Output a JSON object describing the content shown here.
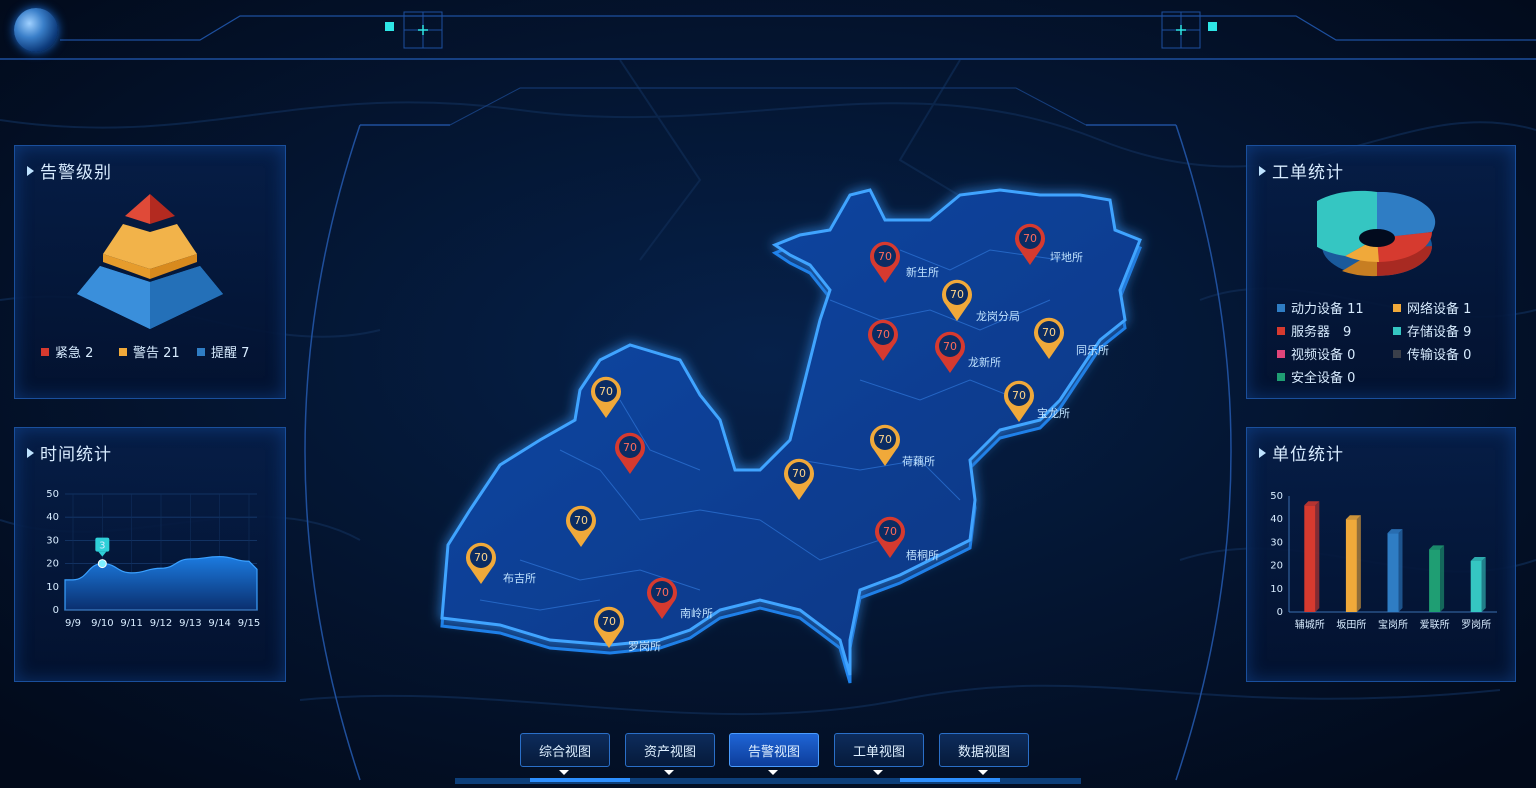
{
  "panels": {
    "alarm_level": {
      "title": "告警级别",
      "legend": [
        {
          "label": "紧急 2",
          "color": "#d63a2f"
        },
        {
          "label": "警告 21",
          "color": "#f0a93a"
        },
        {
          "label": "提醒 7",
          "color": "#2f7dc4"
        }
      ]
    },
    "time_stats": {
      "title": "时间统计",
      "marker_label": "3"
    },
    "work_orders": {
      "title": "工单统计",
      "legend": [
        {
          "label": "动力设备 11",
          "color": "#2f7dc4"
        },
        {
          "label": "网络设备 1",
          "color": "#f0a93a"
        },
        {
          "label": "服务器　9",
          "color": "#d63a2f"
        },
        {
          "label": "存储设备 9",
          "color": "#35c6c2"
        },
        {
          "label": "视频设备 0",
          "color": "#e0457a"
        },
        {
          "label": "传输设备 0",
          "color": "#3a3f4a"
        },
        {
          "label": "安全设备 0",
          "color": "#1f9e73"
        }
      ]
    },
    "unit_stats": {
      "title": "单位统计"
    }
  },
  "chart_data": [
    {
      "type": "area",
      "title": "时间统计",
      "categories": [
        "9/9",
        "9/10",
        "9/11",
        "9/12",
        "9/13",
        "9/14",
        "9/15"
      ],
      "values": [
        13,
        20,
        16,
        18,
        22,
        23,
        21
      ],
      "ylim": [
        0,
        50
      ],
      "yticks": [
        0,
        10,
        20,
        30,
        40,
        50
      ],
      "grid": true
    },
    {
      "type": "bar",
      "title": "单位统计",
      "categories": [
        "辅城所",
        "坂田所",
        "宝岗所",
        "爱联所",
        "罗岗所"
      ],
      "values": [
        46,
        40,
        34,
        27,
        22
      ],
      "colors": [
        "#d63a2f",
        "#f0a93a",
        "#2f7dc4",
        "#1f9e73",
        "#35c6c2"
      ],
      "ylim": [
        0,
        50
      ],
      "yticks": [
        0,
        10,
        20,
        30,
        40,
        50
      ]
    },
    {
      "type": "pie",
      "title": "工单统计",
      "categories": [
        "动力设备",
        "网络设备",
        "服务器",
        "存储设备",
        "视频设备",
        "传输设备",
        "安全设备"
      ],
      "values": [
        11,
        1,
        9,
        9,
        0,
        0,
        0
      ]
    }
  ],
  "map": {
    "pins": [
      {
        "value": "70",
        "label": "坪地所",
        "level": "red"
      },
      {
        "value": "70",
        "label": "新生所",
        "level": "red"
      },
      {
        "value": "70",
        "label": "龙岗分局",
        "level": "orange"
      },
      {
        "value": "70",
        "label": "同乐所",
        "level": "orange"
      },
      {
        "value": "70",
        "label": "",
        "level": "red"
      },
      {
        "value": "70",
        "label": "龙新所",
        "level": "red"
      },
      {
        "value": "70",
        "label": "宝龙所",
        "level": "orange"
      },
      {
        "value": "70",
        "label": "荷藕所",
        "level": "orange"
      },
      {
        "value": "70",
        "label": "",
        "level": "orange"
      },
      {
        "value": "70",
        "label": "梧桐所",
        "level": "red"
      },
      {
        "value": "70",
        "label": "",
        "level": "orange"
      },
      {
        "value": "70",
        "label": "",
        "level": "red"
      },
      {
        "value": "70",
        "label": "",
        "level": "orange"
      },
      {
        "value": "70",
        "label": "布吉所",
        "level": "orange"
      },
      {
        "value": "70",
        "label": "南岭所",
        "level": "red"
      },
      {
        "value": "70",
        "label": "罗岗所",
        "level": "orange"
      }
    ]
  },
  "nav": {
    "buttons": [
      "综合视图",
      "资产视图",
      "告警视图",
      "工单视图",
      "数据视图"
    ],
    "active": "告警视图"
  },
  "colors": {
    "background": "#020b1e",
    "map_fill": "#0b3d8f",
    "map_glow": "#1f8bff",
    "pin_red": "#d63a2f",
    "pin_orange": "#f0a93a"
  }
}
